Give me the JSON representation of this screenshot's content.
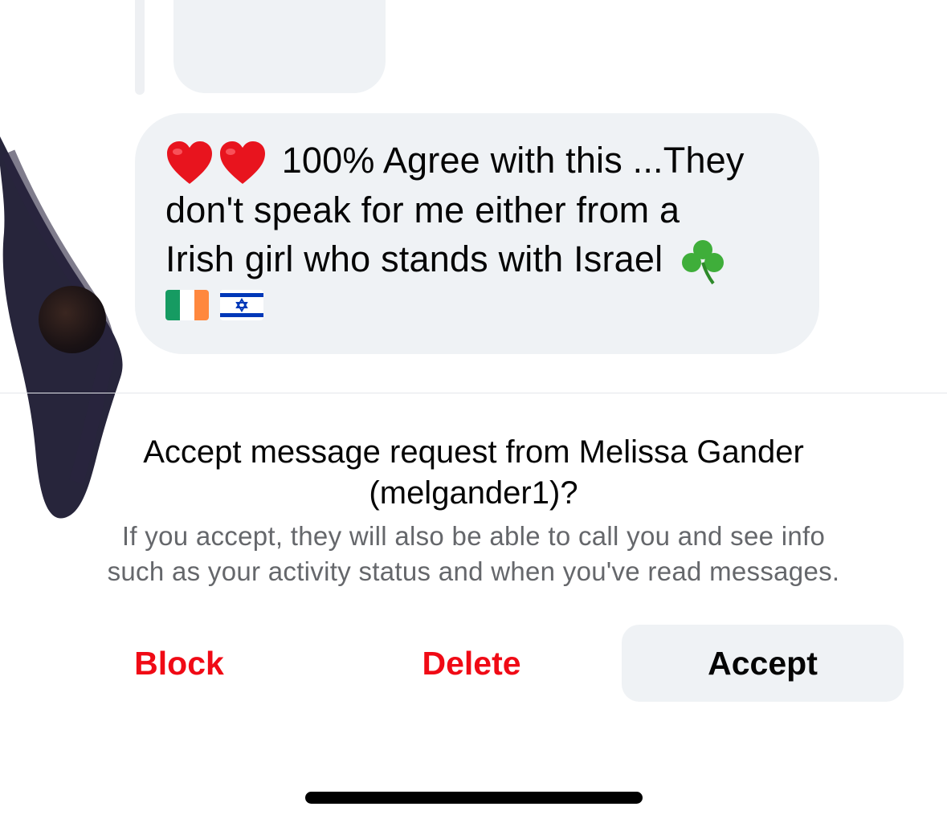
{
  "conversation": {
    "message": {
      "line1_text": "100% Agree with this ...They",
      "line2_text": "don't speak for me either from a",
      "line3_text": "Irish girl who stands with Israel",
      "emojis": [
        "heart-icon",
        "heart-icon",
        "shamrock-icon",
        "ireland-flag-icon",
        "israel-flag-icon"
      ]
    }
  },
  "request": {
    "title_line1": "Accept message request from Melissa Gander",
    "title_line2": "(melgander1)?",
    "desc_line1": "If you accept, they will also be able to call you and see info",
    "desc_line2": "such as your activity status and when you've read messages."
  },
  "actions": {
    "block_label": "Block",
    "delete_label": "Delete",
    "accept_label": "Accept"
  },
  "colors": {
    "destructive": "#f00a15",
    "bubble": "#eff2f5",
    "secondary_text": "#65676b"
  }
}
